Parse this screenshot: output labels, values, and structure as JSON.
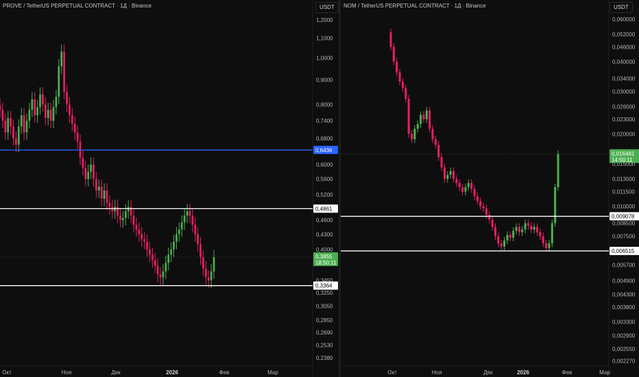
{
  "charts": [
    {
      "id": "left",
      "title": "PROVE / TetherUS PERPETUAL CONTRACT · 1Д · Binance",
      "unit": "USDT",
      "chart_data": {
        "type": "candlestick",
        "scale": "log",
        "y_ticks": [
          "1,2000",
          "1,1000",
          "1,0000",
          "0,9000",
          "0,8000",
          "0,7400",
          "0,6800",
          "0,6000",
          "0,5600",
          "0,5200",
          "0,4600",
          "0,4300",
          "0,4000",
          "0,3450",
          "0,3250",
          "0,3050",
          "0,2850",
          "0,2690",
          "0,2530",
          "0,2380"
        ],
        "y_tick_values": [
          1.2,
          1.1,
          1.0,
          0.9,
          0.8,
          0.74,
          0.68,
          0.6,
          0.56,
          0.52,
          0.46,
          0.43,
          0.4,
          0.345,
          0.325,
          0.305,
          0.285,
          0.269,
          0.253,
          0.238
        ],
        "x_ticks": [
          "Окт",
          "Ноя",
          "Дек",
          "2026",
          "Фев",
          "Мар"
        ],
        "levels": [
          {
            "price": 0.6436,
            "label": "0,6436",
            "color": "#2962ff"
          },
          {
            "price": 0.4861,
            "label": "0,4861",
            "color": "#ffffff"
          },
          {
            "price": 0.3364,
            "label": "0,3364",
            "color": "#ffffff"
          }
        ],
        "current_price": {
          "price": 0.3855,
          "label": "0,3855",
          "countdown": "18:50:11",
          "color": "#4caf50"
        },
        "candles_close": [
          0.78,
          0.74,
          0.7,
          0.75,
          0.72,
          0.68,
          0.66,
          0.72,
          0.76,
          0.7,
          0.74,
          0.78,
          0.82,
          0.76,
          0.79,
          0.84,
          0.8,
          0.75,
          0.78,
          0.74,
          0.79,
          0.83,
          0.96,
          1.03,
          0.85,
          0.8,
          0.76,
          0.73,
          0.7,
          0.67,
          0.62,
          0.59,
          0.56,
          0.58,
          0.6,
          0.56,
          0.53,
          0.54,
          0.51,
          0.53,
          0.5,
          0.49,
          0.48,
          0.49,
          0.47,
          0.46,
          0.465,
          0.48,
          0.49,
          0.47,
          0.45,
          0.44,
          0.43,
          0.42,
          0.415,
          0.4,
          0.39,
          0.38,
          0.37,
          0.355,
          0.35,
          0.36,
          0.375,
          0.39,
          0.4,
          0.415,
          0.43,
          0.44,
          0.455,
          0.47,
          0.48,
          0.47,
          0.45,
          0.43,
          0.41,
          0.385,
          0.365,
          0.35,
          0.345,
          0.36,
          0.3855
        ]
      }
    },
    {
      "id": "right",
      "title": "NOM / TetherUS PERPETUAL CONTRACT · 1Д · Binance",
      "unit": "USDT",
      "chart_data": {
        "type": "candlestick",
        "scale": "log",
        "y_ticks": [
          "0,060000",
          "0,052000",
          "0,046000",
          "0,040000",
          "0,034000",
          "0,030000",
          "0,026000",
          "0,023000",
          "0,020000",
          "0,015000",
          "0,013000",
          "0,011500",
          "0,010000",
          "0,008500",
          "0,007500",
          "0,005700",
          "0,004900",
          "0,004300",
          "0,003800",
          "0,003300",
          "0,002900",
          "0,002550",
          "0,002270"
        ],
        "y_tick_values": [
          0.06,
          0.052,
          0.046,
          0.04,
          0.034,
          0.03,
          0.026,
          0.023,
          0.02,
          0.015,
          0.013,
          0.0115,
          0.01,
          0.0085,
          0.0075,
          0.0057,
          0.0049,
          0.0043,
          0.0038,
          0.0033,
          0.0029,
          0.00255,
          0.00227
        ],
        "x_ticks": [
          "Окт",
          "Ноя",
          "Дек",
          "2026",
          "Фев",
          "Мар"
        ],
        "levels": [
          {
            "price": 0.009078,
            "label": "0,009078",
            "color": "#ffffff"
          },
          {
            "price": 0.006515,
            "label": "0,006515",
            "color": "#ffffff"
          }
        ],
        "current_price": {
          "price": 0.016481,
          "label": "0,016481",
          "countdown": "14:50:11",
          "color": "#4caf50"
        },
        "candles_close": [
          0.046,
          0.04,
          0.036,
          0.033,
          0.031,
          0.028,
          0.02,
          0.019,
          0.021,
          0.022,
          0.024,
          0.023,
          0.025,
          0.021,
          0.019,
          0.018,
          0.016,
          0.0145,
          0.013,
          0.0135,
          0.014,
          0.013,
          0.0125,
          0.012,
          0.0115,
          0.012,
          0.0125,
          0.0118,
          0.011,
          0.0105,
          0.01,
          0.0098,
          0.0092,
          0.0088,
          0.0082,
          0.0075,
          0.007,
          0.0068,
          0.0072,
          0.0076,
          0.0074,
          0.0079,
          0.0082,
          0.0078,
          0.008,
          0.0085,
          0.0083,
          0.008,
          0.0082,
          0.0078,
          0.0075,
          0.007,
          0.0067,
          0.007,
          0.0085,
          0.012,
          0.016481
        ]
      }
    }
  ]
}
